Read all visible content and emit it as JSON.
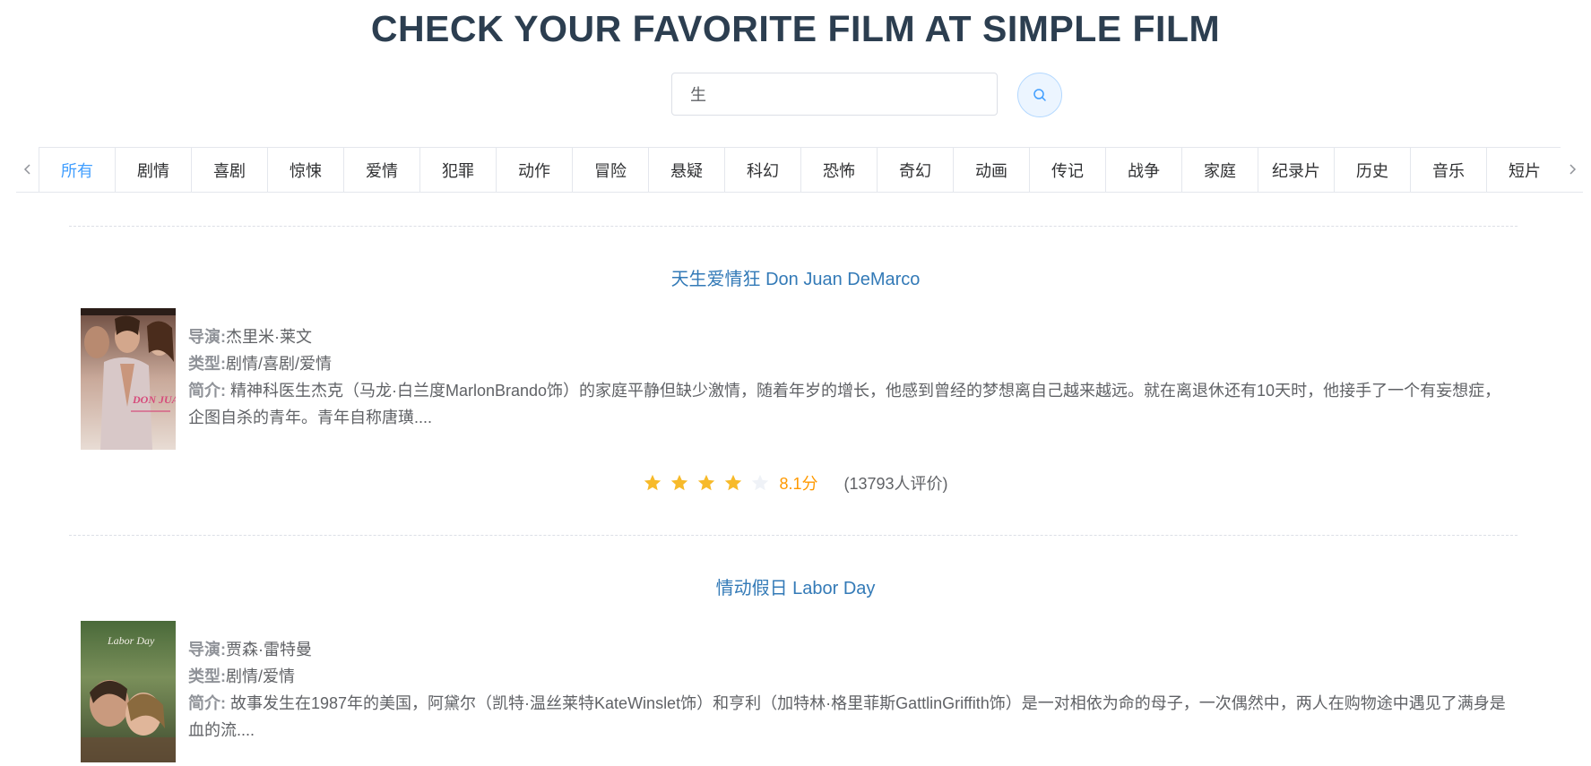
{
  "header": {
    "title": "CHECK YOUR FAVORITE FILM AT SIMPLE FILM"
  },
  "search": {
    "value": "生",
    "placeholder": ""
  },
  "tabs": [
    {
      "label": "所有",
      "active": true
    },
    {
      "label": "剧情"
    },
    {
      "label": "喜剧"
    },
    {
      "label": "惊悚"
    },
    {
      "label": "爱情"
    },
    {
      "label": "犯罪"
    },
    {
      "label": "动作"
    },
    {
      "label": "冒险"
    },
    {
      "label": "悬疑"
    },
    {
      "label": "科幻"
    },
    {
      "label": "恐怖"
    },
    {
      "label": "奇幻"
    },
    {
      "label": "动画"
    },
    {
      "label": "传记"
    },
    {
      "label": "战争"
    },
    {
      "label": "家庭"
    },
    {
      "label": "纪录片"
    },
    {
      "label": "历史"
    },
    {
      "label": "音乐"
    },
    {
      "label": "短片"
    }
  ],
  "labels": {
    "director": "导演:",
    "genre": "类型:",
    "summary": "简介:"
  },
  "movies": [
    {
      "title": "天生爱情狂 Don Juan DeMarco",
      "director": "杰里米·莱文",
      "genre": "剧情/喜剧/爱情",
      "summary": " 精神科医生杰克（马龙·白兰度MarlonBrando饰）的家庭平静但缺少激情，随着年岁的增长，他感到曾经的梦想离自己越来越远。就在离退休还有10天时，他接手了一个有妄想症，企图自杀的青年。青年自称唐璜....",
      "stars_filled": 4,
      "score": "8.1分",
      "rating_count": "(13793人评价)",
      "poster_text": "DON JUAN"
    },
    {
      "title": "情动假日 Labor Day",
      "director": "贾森·雷特曼",
      "genre": "剧情/爱情",
      "summary": " 故事发生在1987年的美国，阿黛尔（凯特·温丝莱特KateWinslet饰）和亨利（加特林·格里菲斯GattlinGriffith饰）是一对相依为命的母子，一次偶然中，两人在购物途中遇见了满身是血的流....",
      "poster_text": "Labor Day"
    }
  ],
  "colors": {
    "accent": "#409eff",
    "title": "#2c3e50",
    "link": "#337ab7",
    "star_filled": "#f7ba2a",
    "star_empty": "#eff2f7",
    "score": "#ff9900"
  }
}
